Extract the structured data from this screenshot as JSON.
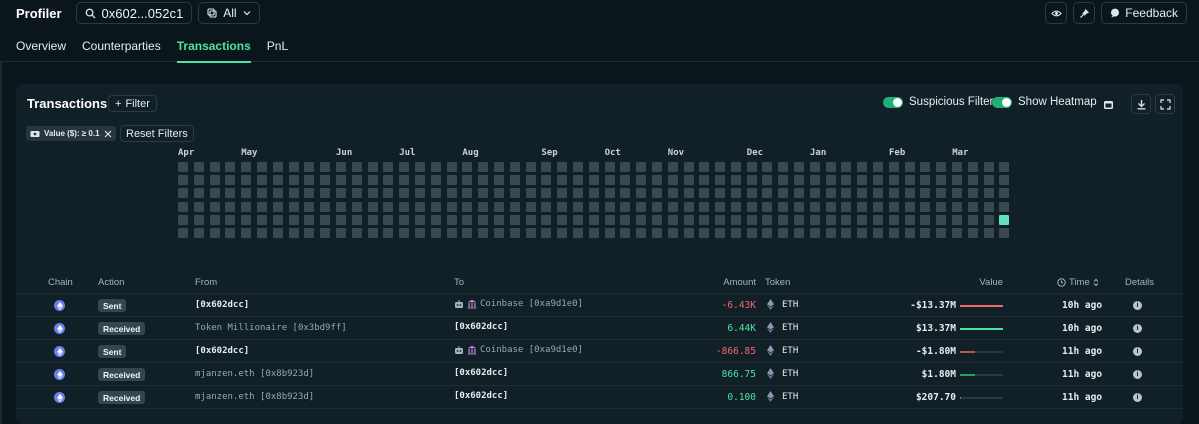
{
  "header": {
    "brand": "Profiler",
    "address": "0x602...052c1",
    "filter_select": "All",
    "feedback_label": "Feedback"
  },
  "tabs": [
    {
      "label": "Overview",
      "active": false
    },
    {
      "label": "Counterparties",
      "active": false
    },
    {
      "label": "Transactions",
      "active": true
    },
    {
      "label": "PnL",
      "active": false
    }
  ],
  "panel": {
    "title": "Transactions",
    "filter_label": "Filter",
    "suspicious_filter_label": "Suspicious Filter",
    "suspicious_filter_on": true,
    "show_heatmap_label": "Show Heatmap",
    "show_heatmap_on": true,
    "active_filter_chip": "Value ($): ≥ 0.1",
    "reset_label": "Reset Filters"
  },
  "heatmap": {
    "months": [
      {
        "label": "Apr",
        "col": 0
      },
      {
        "label": "May",
        "col": 4
      },
      {
        "label": "Jun",
        "col": 10
      },
      {
        "label": "Jul",
        "col": 14
      },
      {
        "label": "Aug",
        "col": 18
      },
      {
        "label": "Sep",
        "col": 23
      },
      {
        "label": "Oct",
        "col": 27
      },
      {
        "label": "Nov",
        "col": 31
      },
      {
        "label": "Dec",
        "col": 36
      },
      {
        "label": "Jan",
        "col": 40
      },
      {
        "label": "Feb",
        "col": 45
      },
      {
        "label": "Mar",
        "col": 49
      }
    ],
    "weeks": 53,
    "days_per_week": 6,
    "active_cells": [
      {
        "week": 52,
        "day": 4
      }
    ],
    "colors": {
      "empty": "#3a4950",
      "active": "#63e2bd"
    }
  },
  "table": {
    "columns": {
      "chain": "Chain",
      "action": "Action",
      "from": "From",
      "to": "To",
      "amount": "Amount",
      "token": "Token",
      "value": "Value",
      "time": "Time",
      "details": "Details"
    },
    "rows": [
      {
        "action": "Sent",
        "from": "[0x602dcc]",
        "from_type": "entity",
        "to": "Coinbase [0xa9d1e0]",
        "to_type": "label",
        "to_icons": true,
        "amount": "-6.43K",
        "amount_sign": "neg",
        "token": "ETH",
        "value": "-$13.37M",
        "value_level": 1.0,
        "value_color": "#ef6b6b",
        "time": "10h ago"
      },
      {
        "action": "Received",
        "from": "Token Millionaire [0x3bd9ff]",
        "from_type": "label",
        "to": "[0x602dcc]",
        "to_type": "entity",
        "to_icons": false,
        "amount": "6.44K",
        "amount_sign": "pos",
        "token": "ETH",
        "value": "$13.37M",
        "value_level": 1.0,
        "value_color": "#4fe3a2",
        "time": "10h ago"
      },
      {
        "action": "Sent",
        "from": "[0x602dcc]",
        "from_type": "entity",
        "to": "Coinbase [0xa9d1e0]",
        "to_type": "label",
        "to_icons": true,
        "amount": "-866.85",
        "amount_sign": "neg",
        "token": "ETH",
        "value": "-$1.80M",
        "value_level": 0.35,
        "value_color": "#b85555",
        "time": "11h ago"
      },
      {
        "action": "Received",
        "from": "mjanzen.eth [0x8b923d]",
        "from_type": "label",
        "to": "[0x602dcc]",
        "to_type": "entity",
        "to_icons": false,
        "amount": "866.75",
        "amount_sign": "pos",
        "token": "ETH",
        "value": "$1.80M",
        "value_level": 0.35,
        "value_color": "#2f9a6a",
        "time": "11h ago"
      },
      {
        "action": "Received",
        "from": "mjanzen.eth [0x8b923d]",
        "from_type": "label",
        "to": "[0x602dcc]",
        "to_type": "entity",
        "to_icons": false,
        "amount": "0.100",
        "amount_sign": "pos",
        "token": "ETH",
        "value": "$207.70",
        "value_level": 0.02,
        "value_color": "#2f9a6a",
        "time": "11h ago"
      }
    ]
  }
}
